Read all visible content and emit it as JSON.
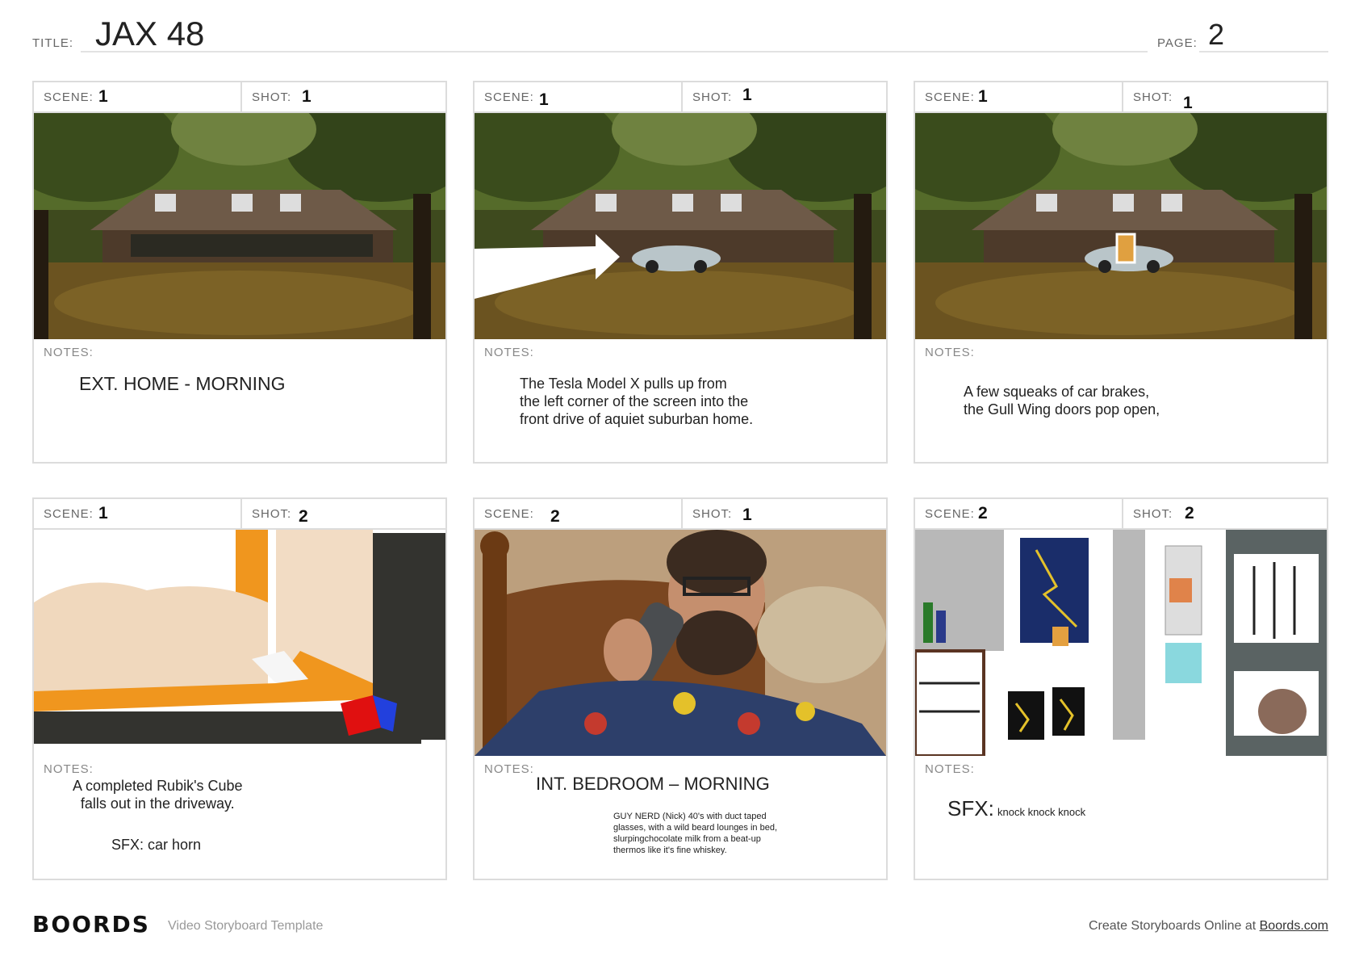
{
  "header": {
    "title_label": "TITLE:",
    "title": "JAX 48",
    "page_label": "PAGE:",
    "page": "2"
  },
  "labels": {
    "scene": "SCENE:",
    "shot": "SHOT:",
    "notes": "NOTES:"
  },
  "panels": [
    {
      "scene": "1",
      "shot": "1",
      "image": "house-exterior",
      "notes": [
        "EXT. HOME - MORNING"
      ]
    },
    {
      "scene": "1",
      "shot": "1",
      "image": "house-car-arriving",
      "notes": [
        "The Tesla Model X pulls up from\nthe left corner of the screen into the\n front drive of aquiet suburban home."
      ]
    },
    {
      "scene": "1",
      "shot": "1",
      "image": "house-car-doors-open",
      "notes": [
        "A few squeaks of car brakes,\n the Gull Wing doors pop open,"
      ]
    },
    {
      "scene": "1",
      "shot": "2",
      "image": "rubiks-cube-sketch",
      "notes": [
        "A completed Rubik's Cube\nfalls out in the driveway.",
        "SFX:  car horn"
      ]
    },
    {
      "scene": "2",
      "shot": "1",
      "image": "man-drinking-in-bed",
      "notes": [
        "INT. BEDROOM – MORNING",
        "GUY NERD (Nick) 40's with duct taped\nglasses, with a wild beard lounges in bed,\nslurpingchocolate milk from a beat-up\n thermos like it's fine whiskey."
      ]
    },
    {
      "scene": "2",
      "shot": "2",
      "image": "closet-sketch",
      "notes": [
        "SFX:",
        "knock knock knock"
      ]
    }
  ],
  "footer": {
    "logo": "BOORDS",
    "subtitle": "Video Storyboard Template",
    "cta_text": "Create Storyboards Online at ",
    "cta_link": "Boords.com"
  }
}
